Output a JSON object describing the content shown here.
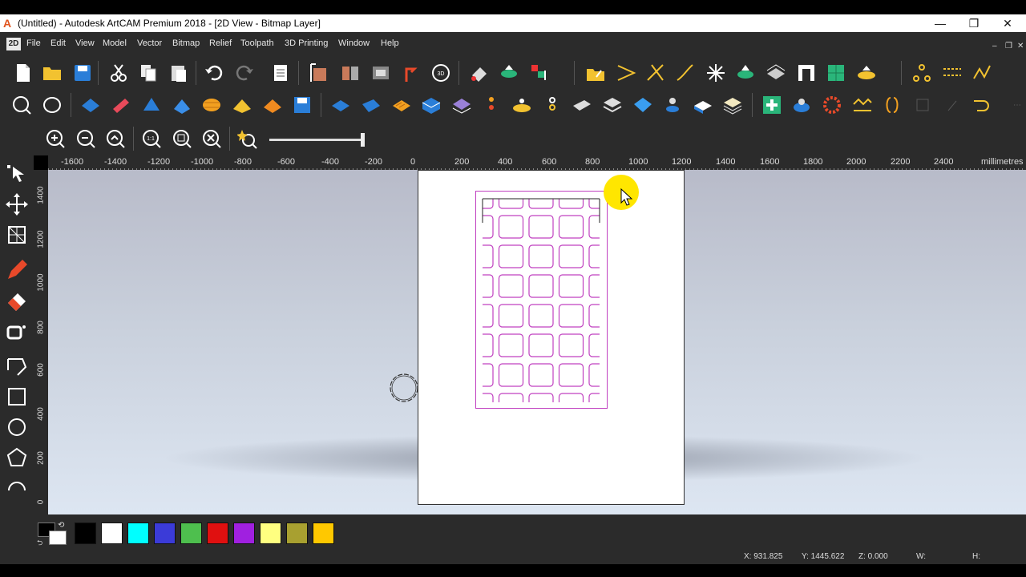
{
  "window": {
    "title": "(Untitled) - Autodesk ArtCAM Premium 2018 - [2D View - Bitmap Layer]",
    "logo_letter": "A",
    "minimize": "—",
    "restore": "❐",
    "close": "✕"
  },
  "menu": {
    "mode_badge": "2D",
    "items": [
      "File",
      "Edit",
      "View",
      "Model",
      "Vector",
      "Bitmap",
      "Relief",
      "Toolpath",
      "3D Printing",
      "Window",
      "Help"
    ],
    "mdi_min": "‒",
    "mdi_restore": "❐",
    "mdi_close": "✕"
  },
  "ruler": {
    "top_labels": [
      "-1600",
      "-1400",
      "-1200",
      "-1000",
      "-800",
      "-600",
      "-400",
      "-200",
      "0",
      "200",
      "400",
      "600",
      "800",
      "1000",
      "1200",
      "1400",
      "1600",
      "1800",
      "2000",
      "2200",
      "2400",
      "millimetres"
    ],
    "left_labels": [
      "1400",
      "1200",
      "1000",
      "800",
      "600",
      "400",
      "200",
      "0"
    ]
  },
  "palette": {
    "colors": [
      "#000000",
      "#ffffff",
      "#00ffff",
      "#3b3bd8",
      "#4ebf4e",
      "#e01010",
      "#a020e0",
      "#ffff80",
      "#a8a030",
      "#ffc800"
    ],
    "primary": "#000000",
    "secondary": "#ffffff"
  },
  "status": {
    "x": "X: 931.825",
    "y": "Y: 1445.622",
    "z": "Z: 0.000",
    "w": "W:",
    "h": "H:"
  },
  "colors": {
    "vector_magenta": "#c040c0",
    "cursor_highlight": "#ffe600"
  }
}
